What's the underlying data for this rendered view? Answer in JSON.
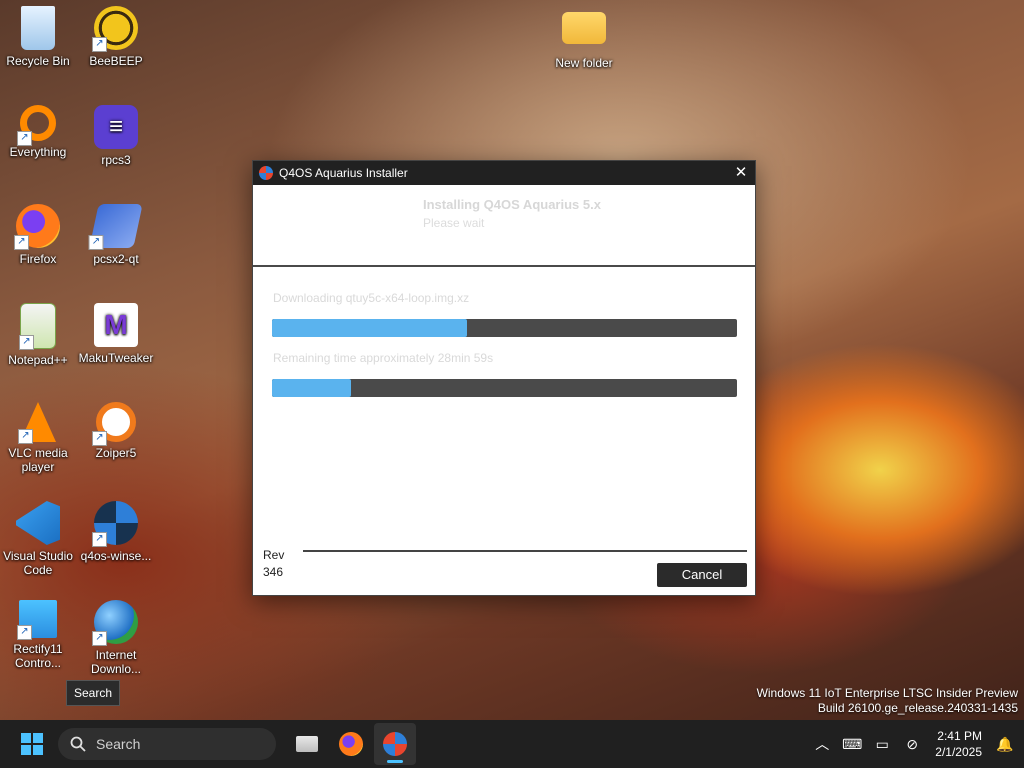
{
  "desktop": {
    "icons": [
      {
        "label": "Recycle Bin"
      },
      {
        "label": "BeeBEEP"
      },
      {
        "label": "New folder"
      },
      {
        "label": "Everything"
      },
      {
        "label": "rpcs3"
      },
      {
        "label": "Firefox"
      },
      {
        "label": "pcsx2-qt"
      },
      {
        "label": "Notepad++"
      },
      {
        "label": "MakuTweaker"
      },
      {
        "label": "VLC media\nplayer"
      },
      {
        "label": "Zoiper5"
      },
      {
        "label": "Visual Studio\nCode"
      },
      {
        "label": "q4os-winse..."
      },
      {
        "label": "Rectify11\nContro..."
      },
      {
        "label": "Internet\nDownlo..."
      }
    ],
    "watermark_line1": "Windows 11 IoT Enterprise LTSC Insider Preview",
    "watermark_line2": "Build 26100.ge_release.240331-1435",
    "tooltip": "Search"
  },
  "dialog": {
    "title": "Q4OS Aquarius Installer",
    "header_title": "Installing Q4OS Aquarius 5.x",
    "header_subtitle": "Please wait",
    "status1": "Downloading qtuy5c-x64-loop.img.xz",
    "progress1": 0.42,
    "status2": "Remaining time approximately 28min 59s",
    "progress2": 0.17,
    "rev_label": "Rev",
    "rev_value": "346",
    "cancel_label": "Cancel"
  },
  "taskbar": {
    "search_placeholder": "Search",
    "time": "2:41 PM",
    "date": "2/1/2025",
    "accent": "#4cc2ff"
  }
}
